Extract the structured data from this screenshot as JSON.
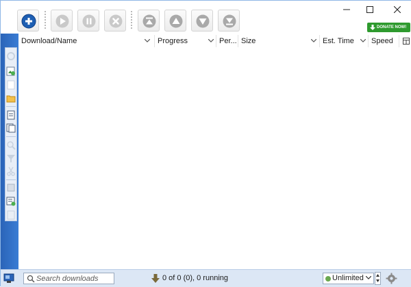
{
  "toolbar": {
    "buttons": [
      {
        "name": "add",
        "icon": "add-circle-icon"
      },
      {
        "name": "resume",
        "icon": "play-icon"
      },
      {
        "name": "pause",
        "icon": "pause-icon"
      },
      {
        "name": "stop",
        "icon": "stop-icon"
      },
      {
        "name": "move-top",
        "icon": "move-top-icon"
      },
      {
        "name": "move-up",
        "icon": "move-up-icon"
      },
      {
        "name": "move-down",
        "icon": "move-down-icon"
      },
      {
        "name": "move-bottom",
        "icon": "move-bottom-icon"
      }
    ],
    "donate_label": "DONATE NOW!"
  },
  "window_controls": [
    "minimize-icon",
    "maximize-icon",
    "close-icon"
  ],
  "columns": [
    "Download/Name",
    "Progress",
    "Per...",
    "Size",
    "Est. Time",
    "Speed"
  ],
  "sidebar": {
    "icons": [
      "refresh-icon",
      "image-add-icon",
      "document-icon",
      "folder-icon",
      "document-edit-icon",
      "document-copy-icon",
      "search-icon",
      "filter-icon",
      "scissors-icon",
      "copy-icon",
      "list-add-icon",
      "list-icon"
    ]
  },
  "status": {
    "search_placeholder": "Search downloads",
    "summary": "0 of 0 (0), 0 running",
    "speed_limit": "Unlimited"
  },
  "colors": {
    "accent": "#2a64b8",
    "donate": "#2e9a2e",
    "statusbar": "#dce7f5"
  }
}
